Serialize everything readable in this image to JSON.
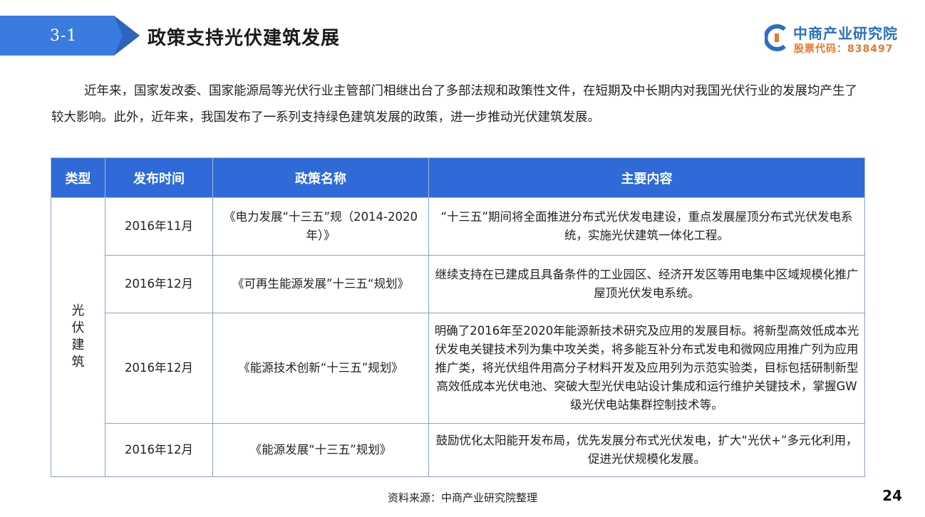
{
  "header": {
    "section_number": "3-1",
    "title": "政策支持光伏建筑发展"
  },
  "logo": {
    "name": "中商产业研究院",
    "stock_code": "股票代码：838497"
  },
  "intro": "近年来，国家发改委、国家能源局等光伏行业主管部门相继出台了多部法规和政策性文件，在短期及中长期内对我国光伏行业的发展均产生了较大影响。此外，近年来，我国发布了一系列支持绿色建筑发展的政策，进一步推动光伏建筑发展。",
  "table": {
    "headers": [
      "类型",
      "发布时间",
      "政策名称",
      "主要内容"
    ],
    "type_label": "光伏建筑",
    "rows": [
      {
        "date": "2016年11月",
        "name": "《电力发展“十三五”规（2014-2020年）》",
        "content": "“十三五”期间将全面推进分布式光伏发电建设，重点发展屋顶分布式光伏发电系统，实施光伏建筑一体化工程。"
      },
      {
        "date": "2016年12月",
        "name": "《可再生能源发展”十三五“规划》",
        "content": "继续支持在已建成且具备条件的工业园区、经济开发区等用电集中区域规模化推广屋顶光伏发电系统。"
      },
      {
        "date": "2016年12月",
        "name": "《能源技术创新“十三五”规划》",
        "content": "明确了2016年至2020年能源新技术研究及应用的发展目标。将新型高效低成本光伏发电关键技术列为集中攻关类，将多能互补分布式发电和微网应用推广列为应用推广类，将光伏组件用高分子材料开发及应用列为示范实验类，目标包括研制新型高效低成本光伏电池、突破大型光伏电站设计集成和运行维护关键技术，掌握GW级光伏电站集群控制技术等。"
      },
      {
        "date": "2016年12月",
        "name": "《能源发展“十三五”规划》",
        "content": "鼓励优化太阳能开发布局，优先发展分布式光伏发电，扩大“光伏+”多元化利用，促进光伏规模化发展。"
      }
    ]
  },
  "footer": {
    "source": "资料来源：中商产业研究院整理",
    "page_number": "24"
  },
  "colors": {
    "header_blue": "#2f6ad8",
    "tag_blue": "#3a7be0",
    "logo_blue": "#2a6fc6",
    "logo_orange": "#e8762c"
  }
}
